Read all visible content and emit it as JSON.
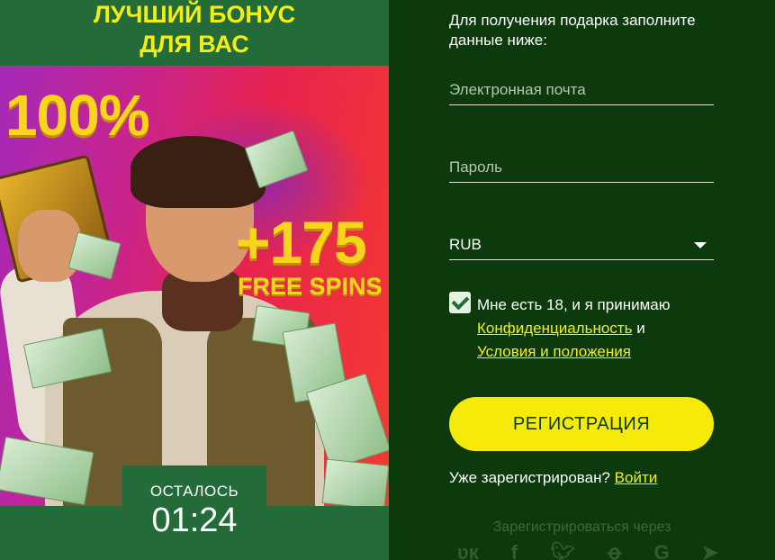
{
  "promo": {
    "title_line1": "ЛУЧШИЙ БОНУС",
    "title_line2": "ДЛЯ ВАС",
    "bonus_percent": "100%",
    "bonus_spins": "+175",
    "bonus_spins_label": "FREE SPINS",
    "timer_label": "ОСТАЛОСЬ",
    "timer_value": "01:24"
  },
  "form": {
    "intro": "Для получения подарка заполните данные ниже:",
    "email_placeholder": "Электронная почта",
    "password_placeholder": "Пароль",
    "currency": "RUB",
    "age_checked": true,
    "terms_text": "Мне есть 18, и я принимаю",
    "privacy_link": "Конфиденциальность",
    "and": "и",
    "conditions_link": "Условия и положения",
    "register_button": "РЕГИСТРАЦИЯ",
    "already_registered": "Уже зарегистрирован?",
    "login_link": "Войти",
    "social_label": "Зарегистрироваться через",
    "social_icons": [
      "vk-icon",
      "facebook-icon",
      "twitter-icon",
      "odnoklassniki-icon",
      "google-icon",
      "telegram-icon"
    ]
  },
  "colors": {
    "accent_yellow": "#f6ea0a",
    "panel_green": "#236b38",
    "dark_green": "#0c3a0c"
  }
}
